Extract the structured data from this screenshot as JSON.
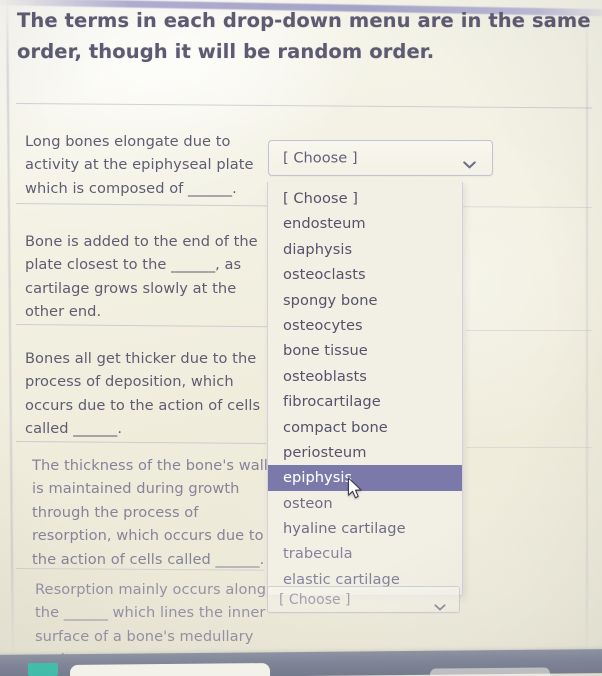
{
  "screen": {
    "headline": "The terms in each drop-down menu are in the same order, though it will be random order."
  },
  "questions": [
    {
      "id": "q1",
      "text": "Long bones elongate due to activity at the epiphyseal plate which is composed of ______."
    },
    {
      "id": "q2",
      "text": "Bone is added to the end of the plate closest to the ______, as cartilage grows slowly at the other end."
    },
    {
      "id": "q3",
      "text": "Bones all get thicker due to the process of deposition, which occurs due to the action of cells called ______."
    },
    {
      "id": "q4",
      "text": "The thickness of the bone's wall is maintained during growth through the process of resorption, which occurs due to the action of cells called ______."
    },
    {
      "id": "q5",
      "text": "Resorption mainly occurs along the ______ which lines the inner surface of a bone's medullary cavity."
    }
  ],
  "dropdowns": {
    "placeholder": "[ Choose ]",
    "open_dropdown_index": 0,
    "selected_option": "epiphysis",
    "highlight_color": "#7a79aa",
    "chevron_icon": "chevron-down-icon",
    "top_select_value": "[ Choose ]",
    "bottom_select_value": "[ Choose ]",
    "options": [
      "[ Choose ]",
      "endosteum",
      "diaphysis",
      "osteoclasts",
      "spongy bone",
      "osteocytes",
      "bone tissue",
      "osteoblasts",
      "fibrocartilage",
      "compact bone",
      "periosteum",
      "epiphysis",
      "osteon",
      "hyaline cartilage",
      "trabecula",
      "elastic cartilage"
    ]
  },
  "cursor": {
    "icon": "mouse-pointer-icon"
  }
}
